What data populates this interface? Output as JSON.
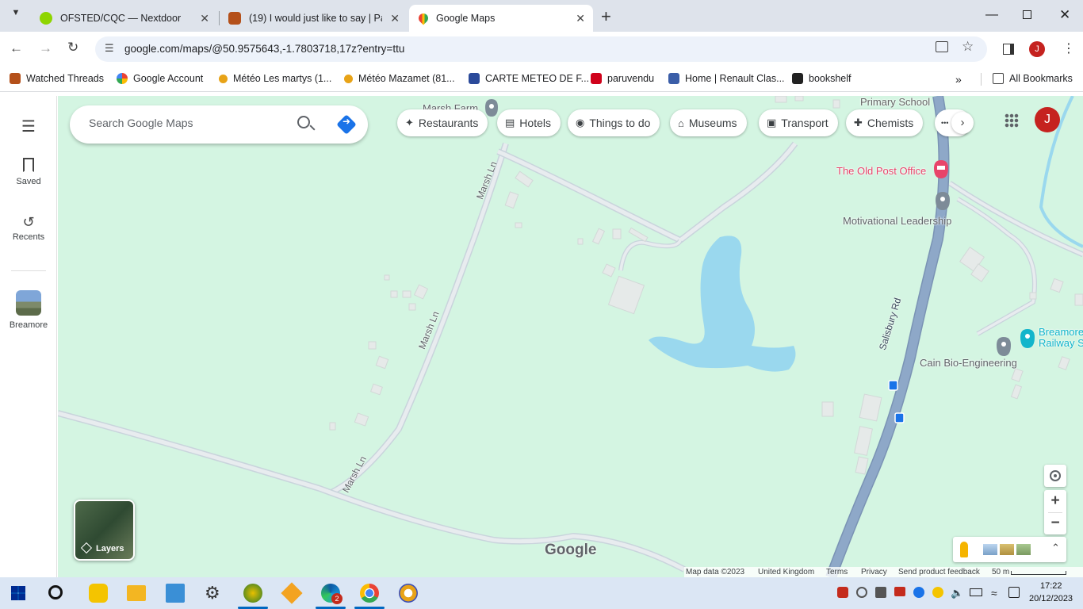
{
  "browser": {
    "tabs": [
      {
        "title": "OFSTED/CQC — Nextdoor",
        "active": false
      },
      {
        "title": "(19) I would just like to say | Pa",
        "active": false
      },
      {
        "title": "Google Maps",
        "active": true
      }
    ],
    "url": "google.com/maps/@50.9575643,-1.7803718,17z?entry=ttu",
    "profile_initial": "J",
    "bookmarks": [
      "Watched Threads",
      "Google Account",
      "Météo Les martys (1...",
      "Météo Mazamet (81...",
      "CARTE METEO DE F...",
      "paruvendu",
      "Home | Renault Clas...",
      "bookshelf"
    ],
    "all_bookmarks": "All Bookmarks"
  },
  "rail": {
    "saved": "Saved",
    "recents": "Recents",
    "recent_place": "Breamore"
  },
  "search": {
    "placeholder": "Search Google Maps"
  },
  "chips": [
    "Restaurants",
    "Hotels",
    "Things to do",
    "Museums",
    "Transport",
    "Chemists"
  ],
  "map": {
    "labels": {
      "marsh_farm": "Marsh Farm",
      "primary_school": "Primary School",
      "old_post_office": "The Old Post Office",
      "motivational": "Motivational Leadership",
      "breamore_railway_1": "Breamore",
      "breamore_railway_2": "Railway S",
      "cain": "Cain Bio-Engineering",
      "salisbury_rd": "Salisbury Rd",
      "marsh_ln_1": "Marsh Ln",
      "marsh_ln_2": "Marsh Ln",
      "marsh_ln_3": "Marsh Ln"
    },
    "layers": "Layers",
    "logo": "Google",
    "account_initial": "J",
    "colors": {
      "land": "#d4f5e2",
      "water": "#9ad8ee",
      "road": "#ffffff",
      "main_road": "#8ea8c8",
      "poi_red": "#e8446a",
      "poi_teal": "#12b5cb"
    },
    "footer": {
      "map_data": "Map data ©2023",
      "country": "United Kingdom",
      "terms": "Terms",
      "privacy": "Privacy",
      "feedback": "Send product feedback",
      "scale": "50 m"
    }
  },
  "taskbar": {
    "time": "17:22",
    "date": "20/12/2023",
    "edge_badge": "2"
  }
}
